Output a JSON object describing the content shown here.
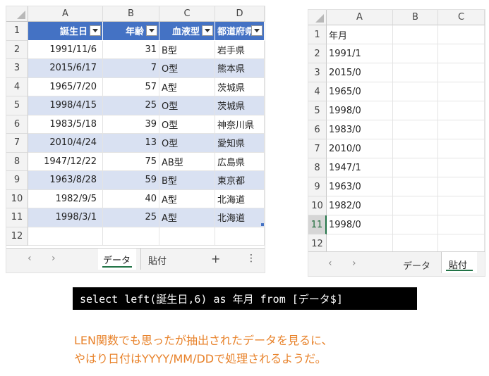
{
  "left_sheet": {
    "columns": [
      "A",
      "B",
      "C",
      "D"
    ],
    "row_numbers": [
      "1",
      "2",
      "3",
      "4",
      "5",
      "6",
      "7",
      "8",
      "9",
      "10",
      "11",
      "12"
    ],
    "headers": [
      "誕生日",
      "年齢",
      "血液型",
      "都道府県"
    ],
    "rows": [
      [
        "1991/11/6",
        "31",
        "B型",
        "岩手県"
      ],
      [
        "2015/6/17",
        "7",
        "O型",
        "熊本県"
      ],
      [
        "1965/7/20",
        "57",
        "A型",
        "茨城県"
      ],
      [
        "1998/4/15",
        "25",
        "O型",
        "茨城県"
      ],
      [
        "1983/5/18",
        "39",
        "O型",
        "神奈川県"
      ],
      [
        "2010/4/24",
        "13",
        "O型",
        "愛知県"
      ],
      [
        "1947/12/22",
        "75",
        "AB型",
        "広島県"
      ],
      [
        "1963/8/28",
        "59",
        "B型",
        "東京都"
      ],
      [
        "1982/9/5",
        "40",
        "A型",
        "北海道"
      ],
      [
        "1998/3/1",
        "25",
        "A型",
        "北海道"
      ]
    ],
    "tabs": [
      "データ",
      "貼付"
    ],
    "add_sheet": "+",
    "more": "⋮",
    "nav_prev": "‹",
    "nav_next": "›"
  },
  "right_sheet": {
    "columns": [
      "A",
      "B",
      "C"
    ],
    "row_numbers": [
      "1",
      "2",
      "3",
      "4",
      "5",
      "6",
      "7",
      "8",
      "9",
      "10",
      "11",
      "12"
    ],
    "values": [
      "年月",
      "1991/1",
      "2015/0",
      "1965/0",
      "1998/0",
      "1983/0",
      "2010/0",
      "1947/1",
      "1963/0",
      "1982/0",
      "1998/0"
    ],
    "tabs": [
      "データ",
      "貼付"
    ],
    "nav_prev": "‹",
    "nav_next": "›"
  },
  "sql": "select left(誕生日,6) as 年月 from [データ$]",
  "note": {
    "line1": "LEN関数でも思ったが抽出されたデータを見るに、",
    "line2": "やはり日付はYYYY/MM/DDで処理されるようだ。"
  },
  "colors": {
    "header_blue": "#4472c4",
    "band_blue": "#d9e1f2",
    "note_orange": "#e8822a",
    "excel_green": "#217346"
  }
}
